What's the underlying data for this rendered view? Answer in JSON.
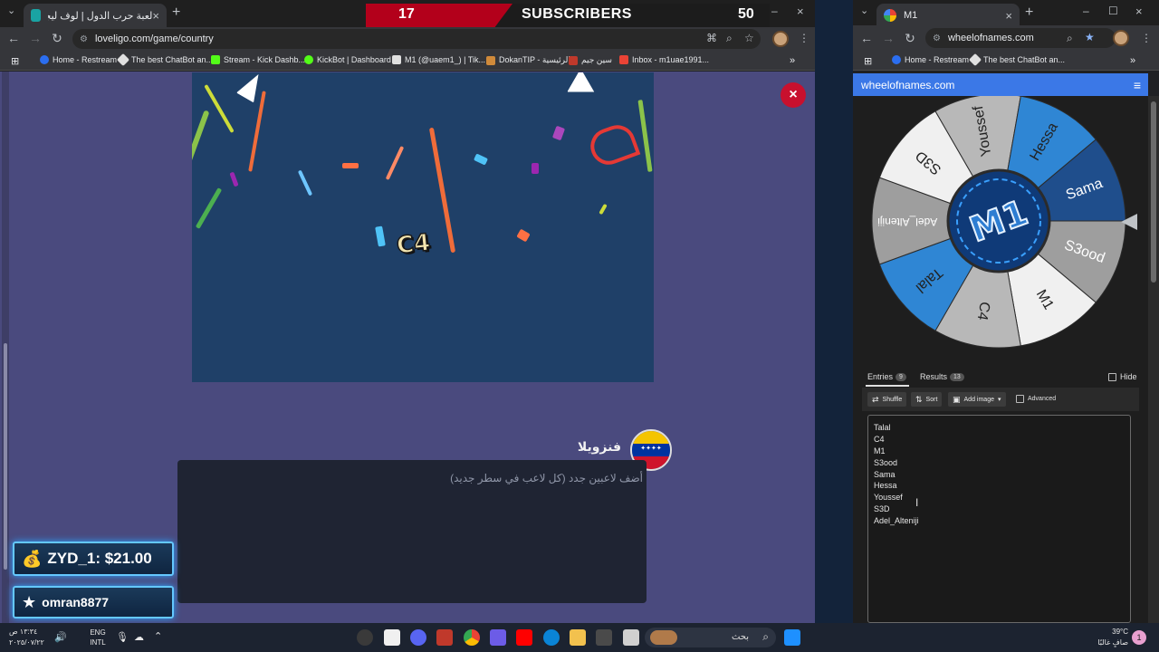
{
  "left_browser": {
    "tab_title": "لعبة حرب الدول | لوف ليجو يوفر",
    "url": "loveligo.com/game/country",
    "bookmarks": [
      {
        "label": "Home - Restream",
        "color": "#2b6ef0"
      },
      {
        "label": "The best ChatBot an...",
        "color": "#e0e0e0"
      },
      {
        "label": "Stream - Kick Dashb...",
        "color": "#53fc18"
      },
      {
        "label": "KickBot | Dashboard",
        "color": "#53fc18"
      },
      {
        "label": "M1 (@uaem1_) | Tik...",
        "color": "#e0e0e0"
      },
      {
        "label": "DokanTIP - الرئيسية",
        "color": "#d08a3a"
      },
      {
        "label": "سين جيم",
        "color": "#c0392b"
      },
      {
        "label": "Inbox - m1uae1991...",
        "color": "#ea4335"
      }
    ]
  },
  "subscribers": {
    "left_count": "17",
    "label": "SUBSCRIBERS",
    "right_count": "50"
  },
  "game": {
    "winner_label": "C4",
    "close_label": "×",
    "country_name": "فنزويلا",
    "players_placeholder": "أضف لاعبين جدد (كل لاعب في سطر جديد)"
  },
  "overlay": {
    "donation": "ZYD_1: $21.00",
    "follower": "omran8877"
  },
  "right_browser": {
    "tab_title": "M1",
    "url": "wheelofnames.com",
    "bookmarks": [
      {
        "label": "Home - Restream",
        "color": "#2b6ef0"
      },
      {
        "label": "The best ChatBot an...",
        "color": "#e0e0e0"
      }
    ],
    "site_title": "wheelofnames.com",
    "tabs": {
      "entries_label": "Entries",
      "entries_count": "9",
      "results_label": "Results",
      "results_count": "13",
      "hide_label": "Hide"
    },
    "tools": {
      "shuffle": "Shuffle",
      "sort": "Sort",
      "add_image": "Add image",
      "advanced": "Advanced"
    },
    "entries": [
      "Talal",
      "C4",
      "M1",
      "S3ood",
      "Sama",
      "Hessa",
      "Youssef",
      "S3D",
      "Adel_Alteniji"
    ]
  },
  "wheel": {
    "center_label": "M1",
    "segments": [
      {
        "name": "Sama",
        "color": "#1f4e8c",
        "text_color": "#ffffff"
      },
      {
        "name": "S3ood",
        "color": "#9e9e9e",
        "text_color": "#ffffff"
      },
      {
        "name": "M1",
        "color": "#f0f0f0",
        "text_color": "#222222"
      },
      {
        "name": "C4",
        "color": "#b8b8b8",
        "text_color": "#222222"
      },
      {
        "name": "Talal",
        "color": "#2f86d4",
        "text_color": "#222222"
      },
      {
        "name": "Adel_Alteniji",
        "color": "#9e9e9e",
        "text_color": "#ffffff"
      },
      {
        "name": "S3D",
        "color": "#f0f0f0",
        "text_color": "#222222"
      },
      {
        "name": "Youssef",
        "color": "#b8b8b8",
        "text_color": "#222222"
      },
      {
        "name": "Hessa",
        "color": "#2f86d4",
        "text_color": "#222222"
      }
    ]
  },
  "taskbar": {
    "time": "١٣:٣٤ ص",
    "date": "٢٠٢٥/٠٧/٢٢",
    "lang_top": "ENG",
    "lang_bottom": "INTL",
    "search_placeholder": "بحث",
    "temp": "39°C",
    "weather": "صافٍ غالبًا",
    "notification_count": "1"
  }
}
